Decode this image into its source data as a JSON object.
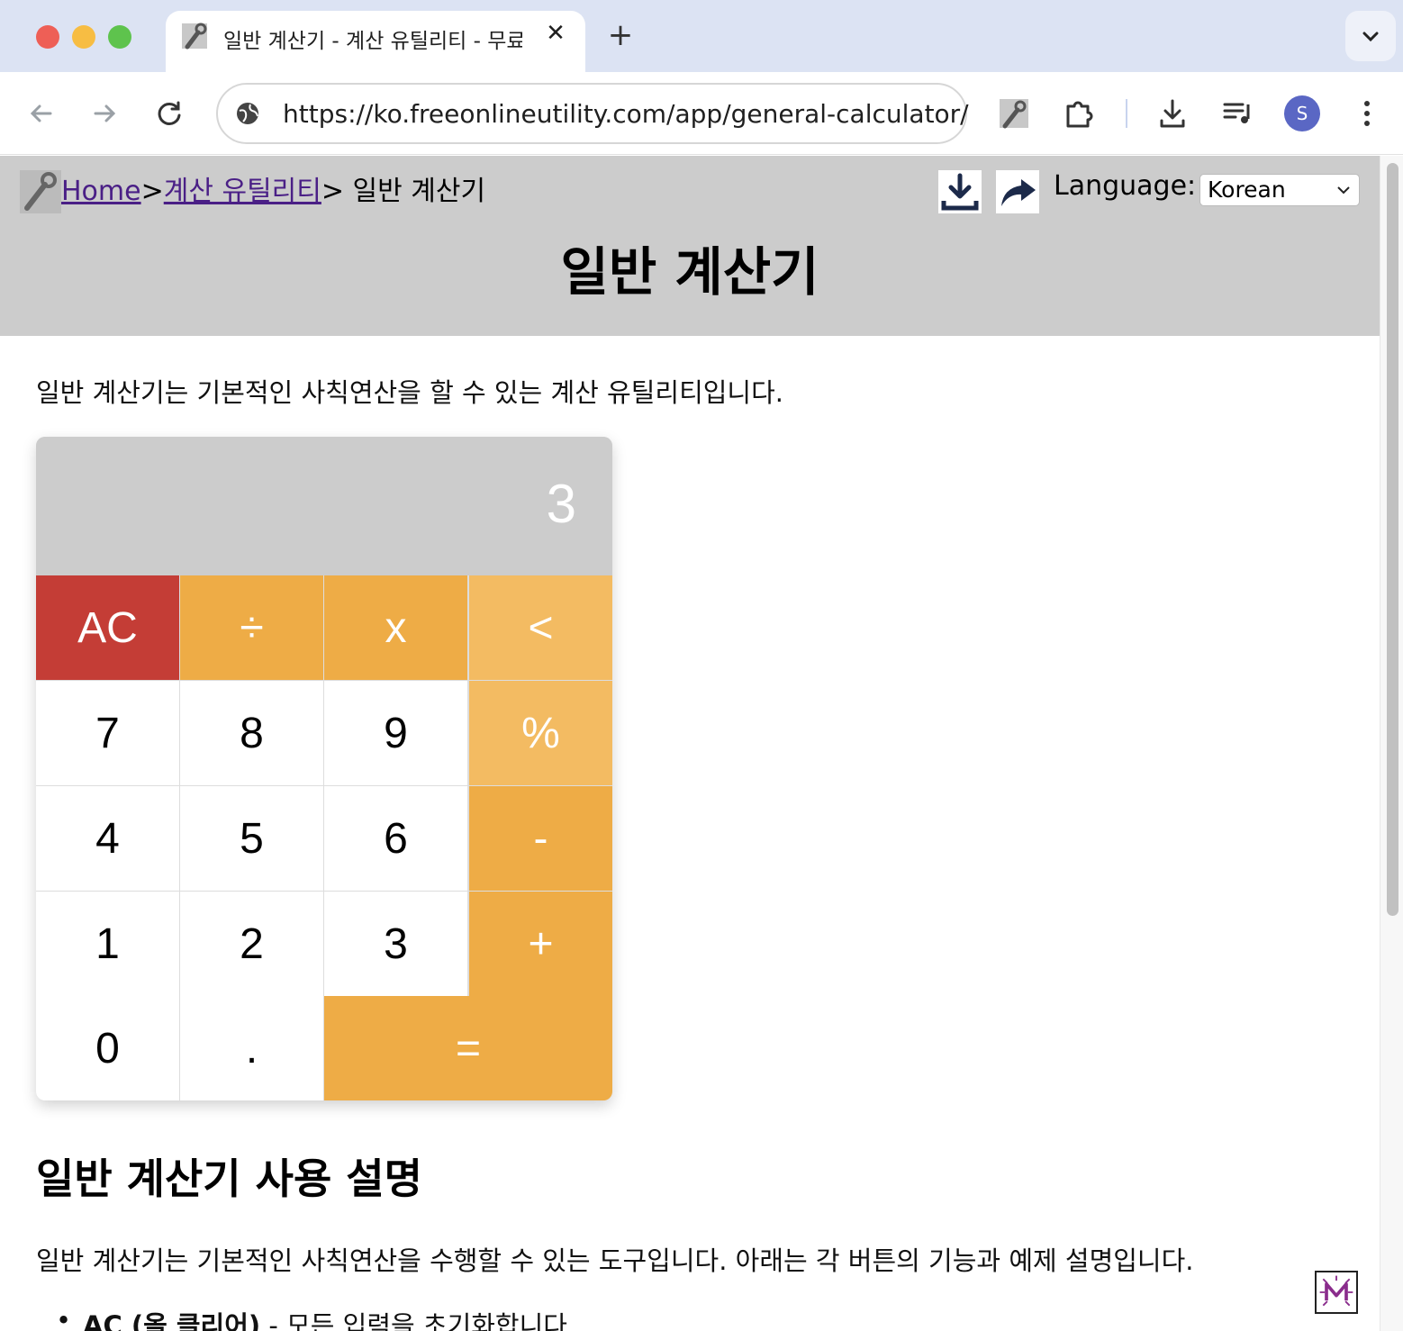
{
  "browser": {
    "tab_title": "일반 계산기 - 계산 유틸리티 - 무료",
    "url": "https://ko.freeonlineutility.com/app/general-calculator/",
    "avatar_initial": "S"
  },
  "header": {
    "breadcrumb_home": "Home",
    "breadcrumb_sep1": ">",
    "breadcrumb_category": "계산 유틸리티",
    "breadcrumb_current": "> 일반 계산기",
    "language_label": "Language:",
    "language_selected": "Korean",
    "page_title": "일반 계산기"
  },
  "intro": "일반 계산기는 기본적인 사칙연산을 할 수 있는 계산 유틸리티입니다.",
  "calculator": {
    "display": "3",
    "keys": {
      "ac": "AC",
      "divide": "÷",
      "multiply": "x",
      "backspace": "<",
      "seven": "7",
      "eight": "8",
      "nine": "9",
      "percent": "%",
      "four": "4",
      "five": "5",
      "six": "6",
      "minus": "-",
      "one": "1",
      "two": "2",
      "three": "3",
      "plus": "+",
      "zero": "0",
      "dot": ".",
      "equals": "="
    }
  },
  "usage": {
    "title": "일반 계산기 사용 설명",
    "description": "일반 계산기는 기본적인 사칙연산을 수행할 수 있는 도구입니다. 아래는 각 버튼의 기능과 예제 설명입니다.",
    "bullet_term": "AC (올 클리어)",
    "bullet_text": " - 모든 입력을 초기화합니다."
  },
  "colors": {
    "ac": "#c43d36",
    "operator": "#eeac46",
    "operator_light": "#f3bb62",
    "header_bg": "#cccccc"
  }
}
